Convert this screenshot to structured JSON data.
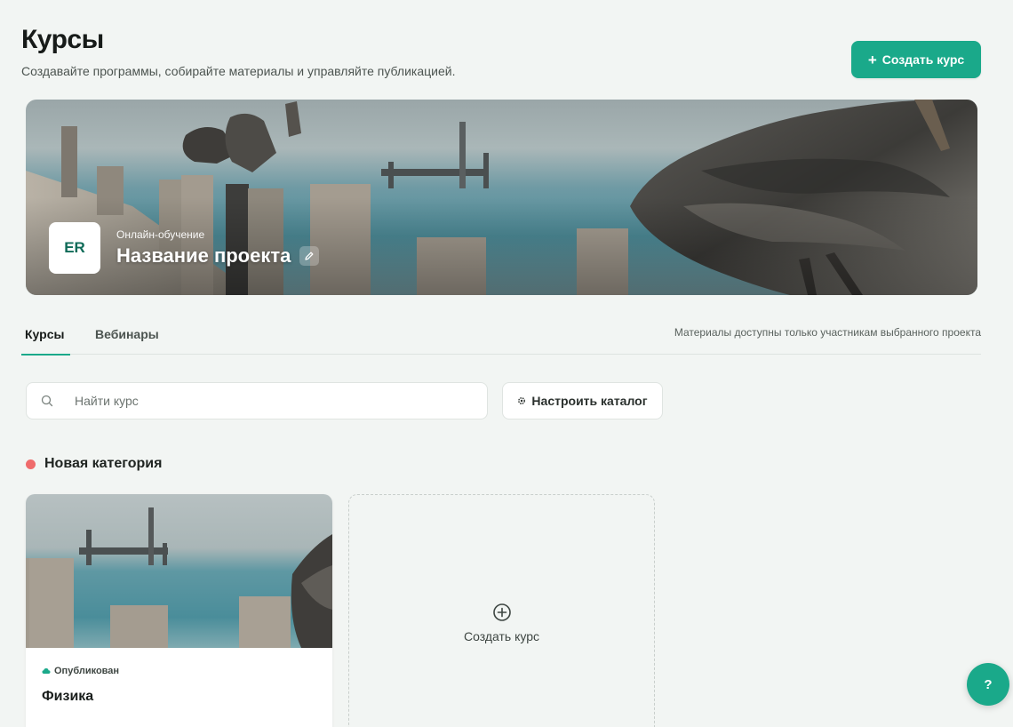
{
  "header": {
    "title": "Курсы",
    "subtitle": "Создавайте программы, собирайте материалы и управляйте публикацией.",
    "create_button_label": "Создать курс"
  },
  "project": {
    "logo_initials": "ER",
    "type_label": "Онлайн-обучение",
    "name": "Название проекта",
    "cover_icon": "photo-pelicans-pier",
    "edit_icon": "pencil-icon"
  },
  "tabs": {
    "items": [
      {
        "label": "Курсы",
        "active": true
      },
      {
        "label": "Вебинары",
        "active": false
      }
    ],
    "note": "Материалы доступны только участникам выбранного проекта"
  },
  "search": {
    "placeholder": "Найти курс",
    "value": ""
  },
  "catalog_button": {
    "label": "Настроить каталог",
    "icon": "gear-icon"
  },
  "category": {
    "name": "Новая категория",
    "color": "#ef6b6b"
  },
  "courses": [
    {
      "title": "Физика",
      "status": "Опубликован",
      "status_icon": "cloud-icon"
    }
  ],
  "create_card": {
    "label": "Создать курс",
    "icon": "plus-circle-icon"
  },
  "help": {
    "label": "?"
  },
  "colors": {
    "accent": "#1aa98a",
    "background": "#f2f5f3",
    "category_dot": "#ef6b6b",
    "logo_text": "#0f6b58"
  }
}
